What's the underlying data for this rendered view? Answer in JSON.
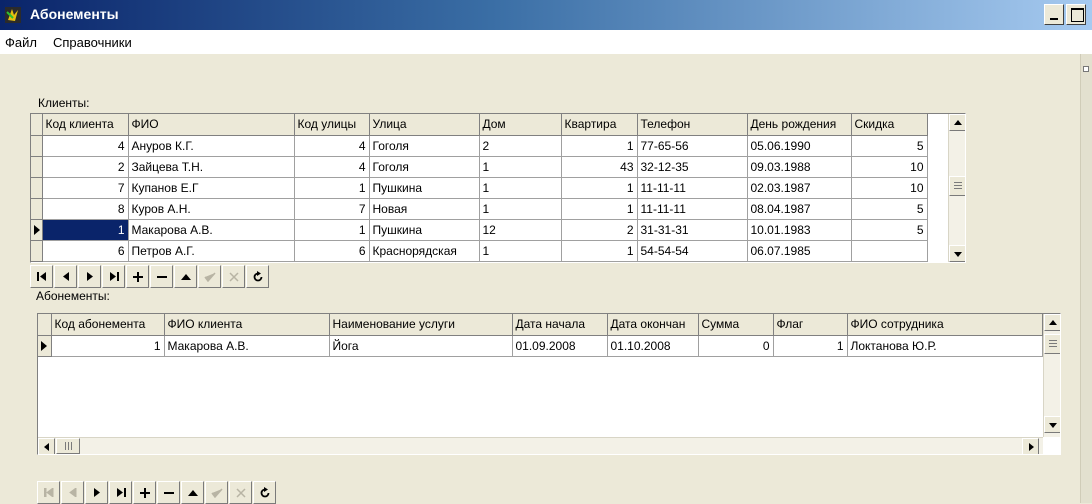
{
  "window": {
    "title": "Абонементы"
  },
  "menu": {
    "items": [
      "Файл",
      "Справочники"
    ]
  },
  "clients": {
    "label": "Клиенты:",
    "columns": [
      "Код клиента",
      "ФИО",
      "Код улицы",
      "Улица",
      "Дом",
      "Квартира",
      "Телефон",
      "День рождения",
      "Скидка"
    ],
    "rows": [
      [
        "4",
        "Ануров К.Г.",
        "4",
        "Гоголя",
        "2",
        "1",
        "77-65-56",
        "05.06.1990",
        "5"
      ],
      [
        "2",
        "Зайцева Т.Н.",
        "4",
        "Гоголя",
        "1",
        "43",
        "32-12-35",
        "09.03.1988",
        "10"
      ],
      [
        "7",
        "Купанов Е.Г",
        "1",
        "Пушкина",
        "1",
        "1",
        "11-11-11",
        "02.03.1987",
        "10"
      ],
      [
        "8",
        "Куров А.Н.",
        "7",
        "Новая",
        "1",
        "1",
        "11-11-11",
        "08.04.1987",
        "5"
      ],
      [
        "1",
        "Макарова А.В.",
        "1",
        "Пушкина",
        "12",
        "2",
        "31-31-31",
        "10.01.1983",
        "5"
      ],
      [
        "6",
        "Петров А.Г.",
        "6",
        "Краснорядская",
        "1",
        "1",
        "54-54-54",
        "06.07.1985",
        ""
      ]
    ]
  },
  "subscriptions": {
    "label": "Абонементы:",
    "columns": [
      "Код абонемента",
      "ФИО клиента",
      "Наименование услуги",
      "Дата начала",
      "Дата окончан",
      "Сумма",
      "Флаг",
      "ФИО сотрудника"
    ],
    "rows": [
      [
        "1",
        "Макарова А.В.",
        "Йога",
        "01.09.2008",
        "01.10.2008",
        "0",
        "1",
        "Локтанова Ю.Р."
      ]
    ]
  }
}
